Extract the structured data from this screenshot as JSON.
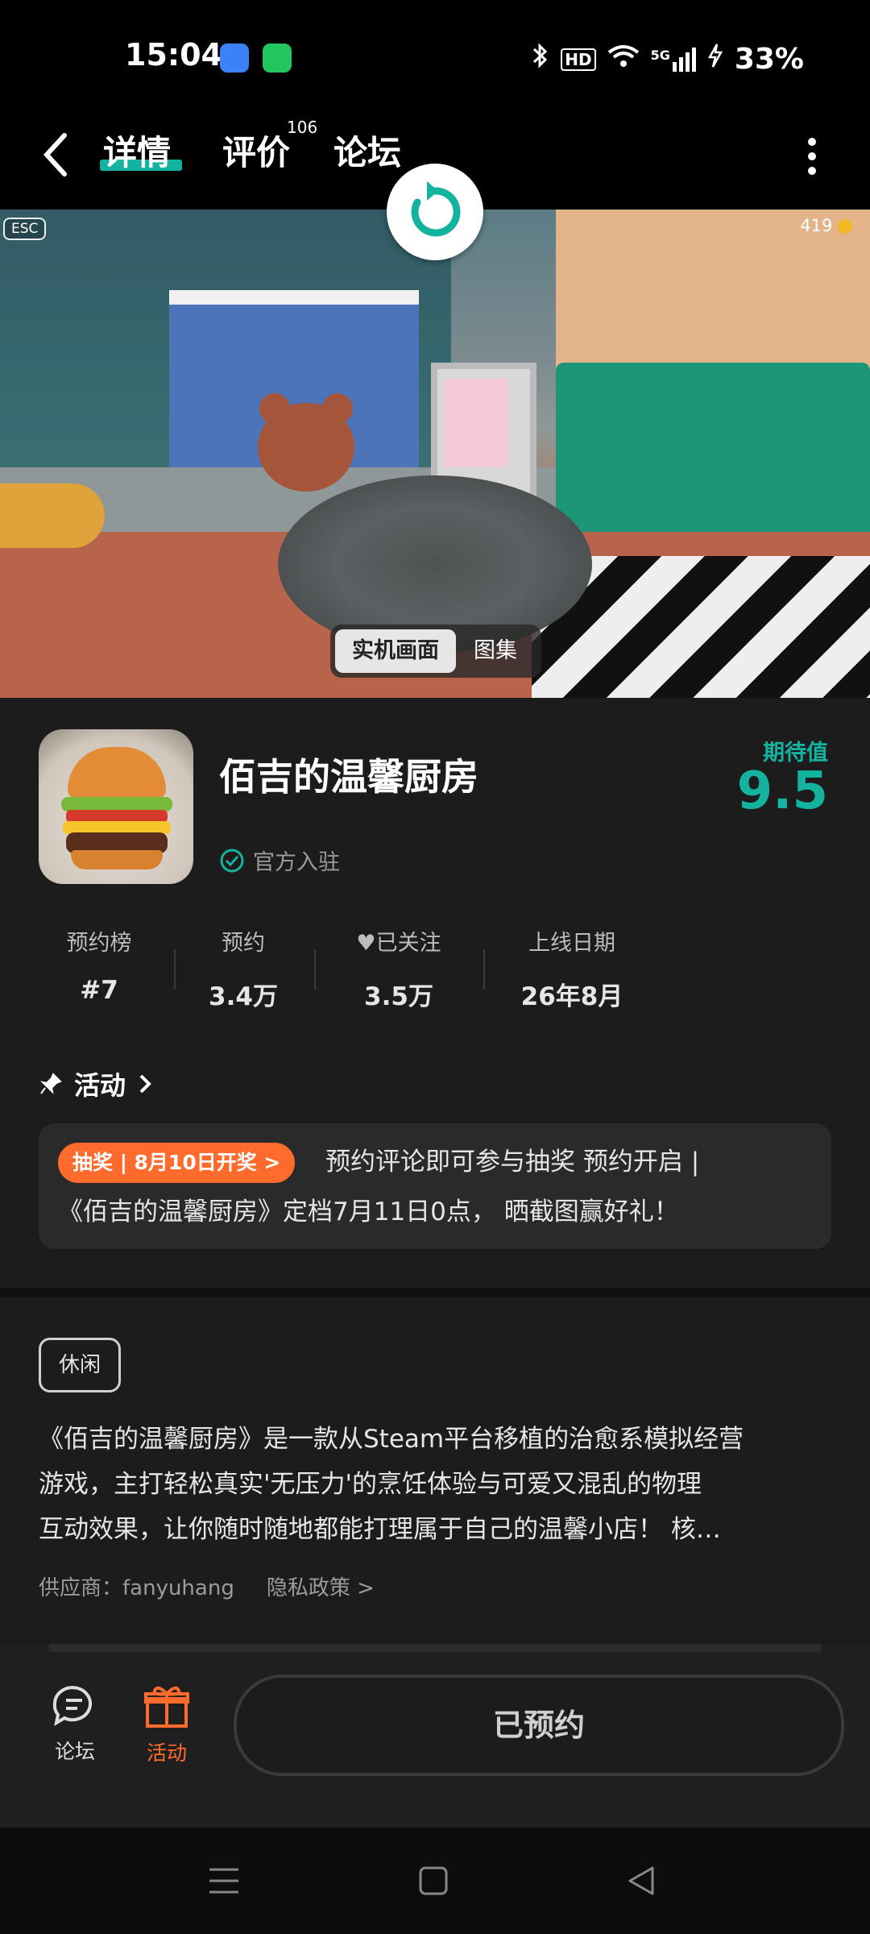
{
  "status_bar": {
    "time": "15:04",
    "battery_percent": "33%",
    "network": "5G",
    "hd": "HD"
  },
  "header": {
    "back_icon": "chevron-left-icon",
    "tabs": [
      {
        "label": "详情",
        "active": true
      },
      {
        "label": "评价",
        "badge": "106"
      },
      {
        "label": "论坛"
      }
    ],
    "more_icon": "more-vertical-icon"
  },
  "hero": {
    "esc_label": "ESC",
    "coins": "419",
    "segment": {
      "active": "实机画面",
      "inactive": "图集"
    }
  },
  "game": {
    "title": "佰吉的温馨厨房",
    "official_label": "官方入驻",
    "expectation_label": "期待值",
    "expectation_value": "9.5"
  },
  "stats": [
    {
      "label": "预约榜",
      "value": "#7"
    },
    {
      "label": "预约",
      "value": "3.4万"
    },
    {
      "label": "已关注",
      "value": "3.5万"
    },
    {
      "label": "上线日期",
      "value": "26年8月"
    }
  ],
  "activity": {
    "heading": "活动",
    "tag": "抽奖 | 8月10日开奖 >",
    "line1": "预约评论即可参与抽奖 预约开启 |",
    "line2": "《佰吉的温馨厨房》定档7月11日0点， 晒截图赢好礼！"
  },
  "detail": {
    "genre": "休闲",
    "description": [
      "《佰吉的温馨厨房》是一款从Steam平台移植的治愈系模拟经营",
      "游戏，主打轻松真实'无压力'的烹饪体验与可爱又混乱的物理",
      "互动效果，让你随时随地都能打理属于自己的温馨小店！ 核…"
    ],
    "supplier": "供应商：fanyuhang",
    "privacy": "隐私政策 >"
  },
  "bottom": {
    "forum_label": "论坛",
    "activity_label": "活动",
    "reserve_button": "已预约"
  },
  "colors": {
    "accent": "#14b3a0",
    "orange": "#ff6a2d",
    "background": "#1c1c1c"
  }
}
